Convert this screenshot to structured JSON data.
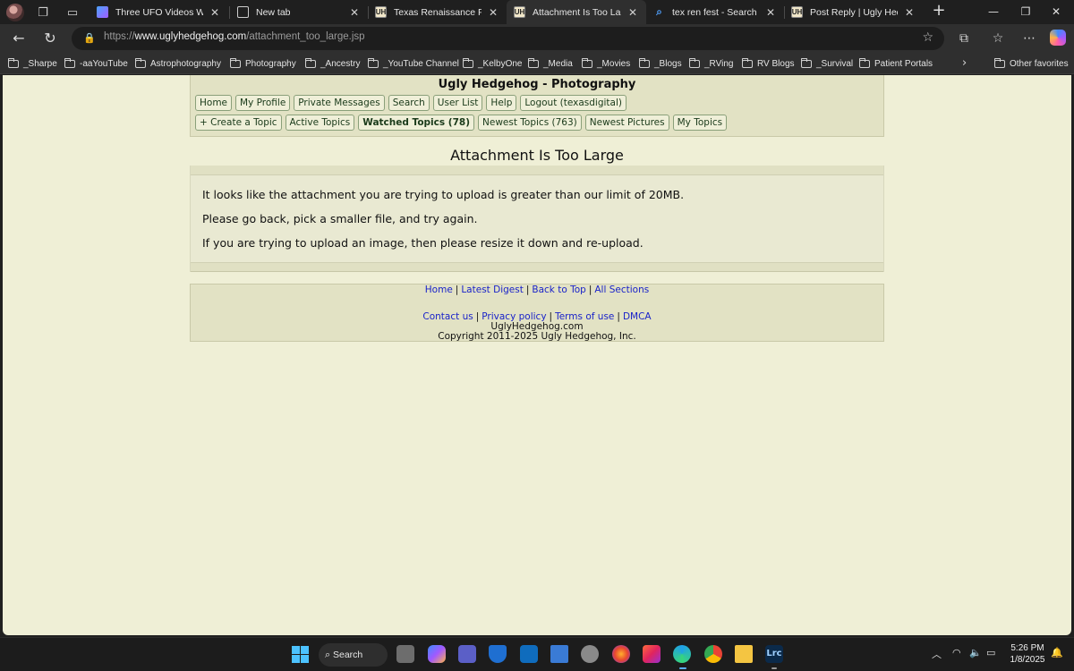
{
  "browser": {
    "tabs": [
      {
        "title": "Three UFO Videos Worth",
        "favicon": "msn-icon",
        "active": false
      },
      {
        "title": "New tab",
        "favicon": "new-tab-icon",
        "active": false
      },
      {
        "title": "Texas Renaissance Festiva",
        "favicon": "ugly-hedgehog-icon",
        "active": false
      },
      {
        "title": "Attachment Is Too Large |",
        "favicon": "ugly-hedgehog-icon",
        "active": true
      },
      {
        "title": "tex ren fest - Search",
        "favicon": "bing-search-icon",
        "active": false
      },
      {
        "title": "Post Reply | Ugly Hedgeh",
        "favicon": "ugly-hedgehog-icon",
        "active": false
      }
    ],
    "url_prefix": "https://",
    "url_host": "www.uglyhedgehog.com",
    "url_path": "/attachment_too_large.jsp",
    "bookmarks": [
      "_Sharpe",
      "-aaYouTube",
      "Astrophotography",
      "Photography",
      "_Ancestry",
      "_YouTube Channel",
      "_KelbyOne",
      "_Media",
      "_Movies",
      "_Blogs",
      "_RVing",
      "RV Blogs",
      "_Survival",
      "Patient Portals"
    ],
    "other_favorites": "Other favorites"
  },
  "site": {
    "title": "Ugly Hedgehog - Photography",
    "nav_row1": [
      "Home",
      "My Profile",
      "Private Messages",
      "Search",
      "User List",
      "Help",
      "Logout (texasdigital)"
    ],
    "nav_row2": [
      {
        "label": "+ Create a Topic",
        "bold": false
      },
      {
        "label": "Active Topics",
        "bold": false
      },
      {
        "label": "Watched Topics (78)",
        "bold": true
      },
      {
        "label": "Newest Topics (763)",
        "bold": false
      },
      {
        "label": "Newest Pictures",
        "bold": false
      },
      {
        "label": "My Topics",
        "bold": false
      }
    ]
  },
  "content": {
    "heading": "Attachment Is Too Large",
    "lines": [
      "It looks like the attachment you are trying to upload is greater than our limit of 20MB.",
      "Please go back, pick a smaller file, and try again.",
      "If you are trying to upload an image, then please resize it down and re-upload."
    ]
  },
  "footer": {
    "links1": [
      "Home",
      "Latest Digest",
      "Back to Top",
      "All Sections"
    ],
    "links2": [
      "Contact us",
      "Privacy policy",
      "Terms of use",
      "DMCA"
    ],
    "site_name": "UglyHedgehog.com",
    "copyright": "Copyright 2011-2025 Ugly Hedgehog, Inc."
  },
  "taskbar": {
    "search_label": "Search",
    "time": "5:26 PM",
    "date": "1/8/2025"
  },
  "colors": {
    "page_bg": "#efefd6",
    "panel_bg": "#e2e2c4",
    "link": "#1a23c9",
    "nav_border": "#8aa07a"
  }
}
